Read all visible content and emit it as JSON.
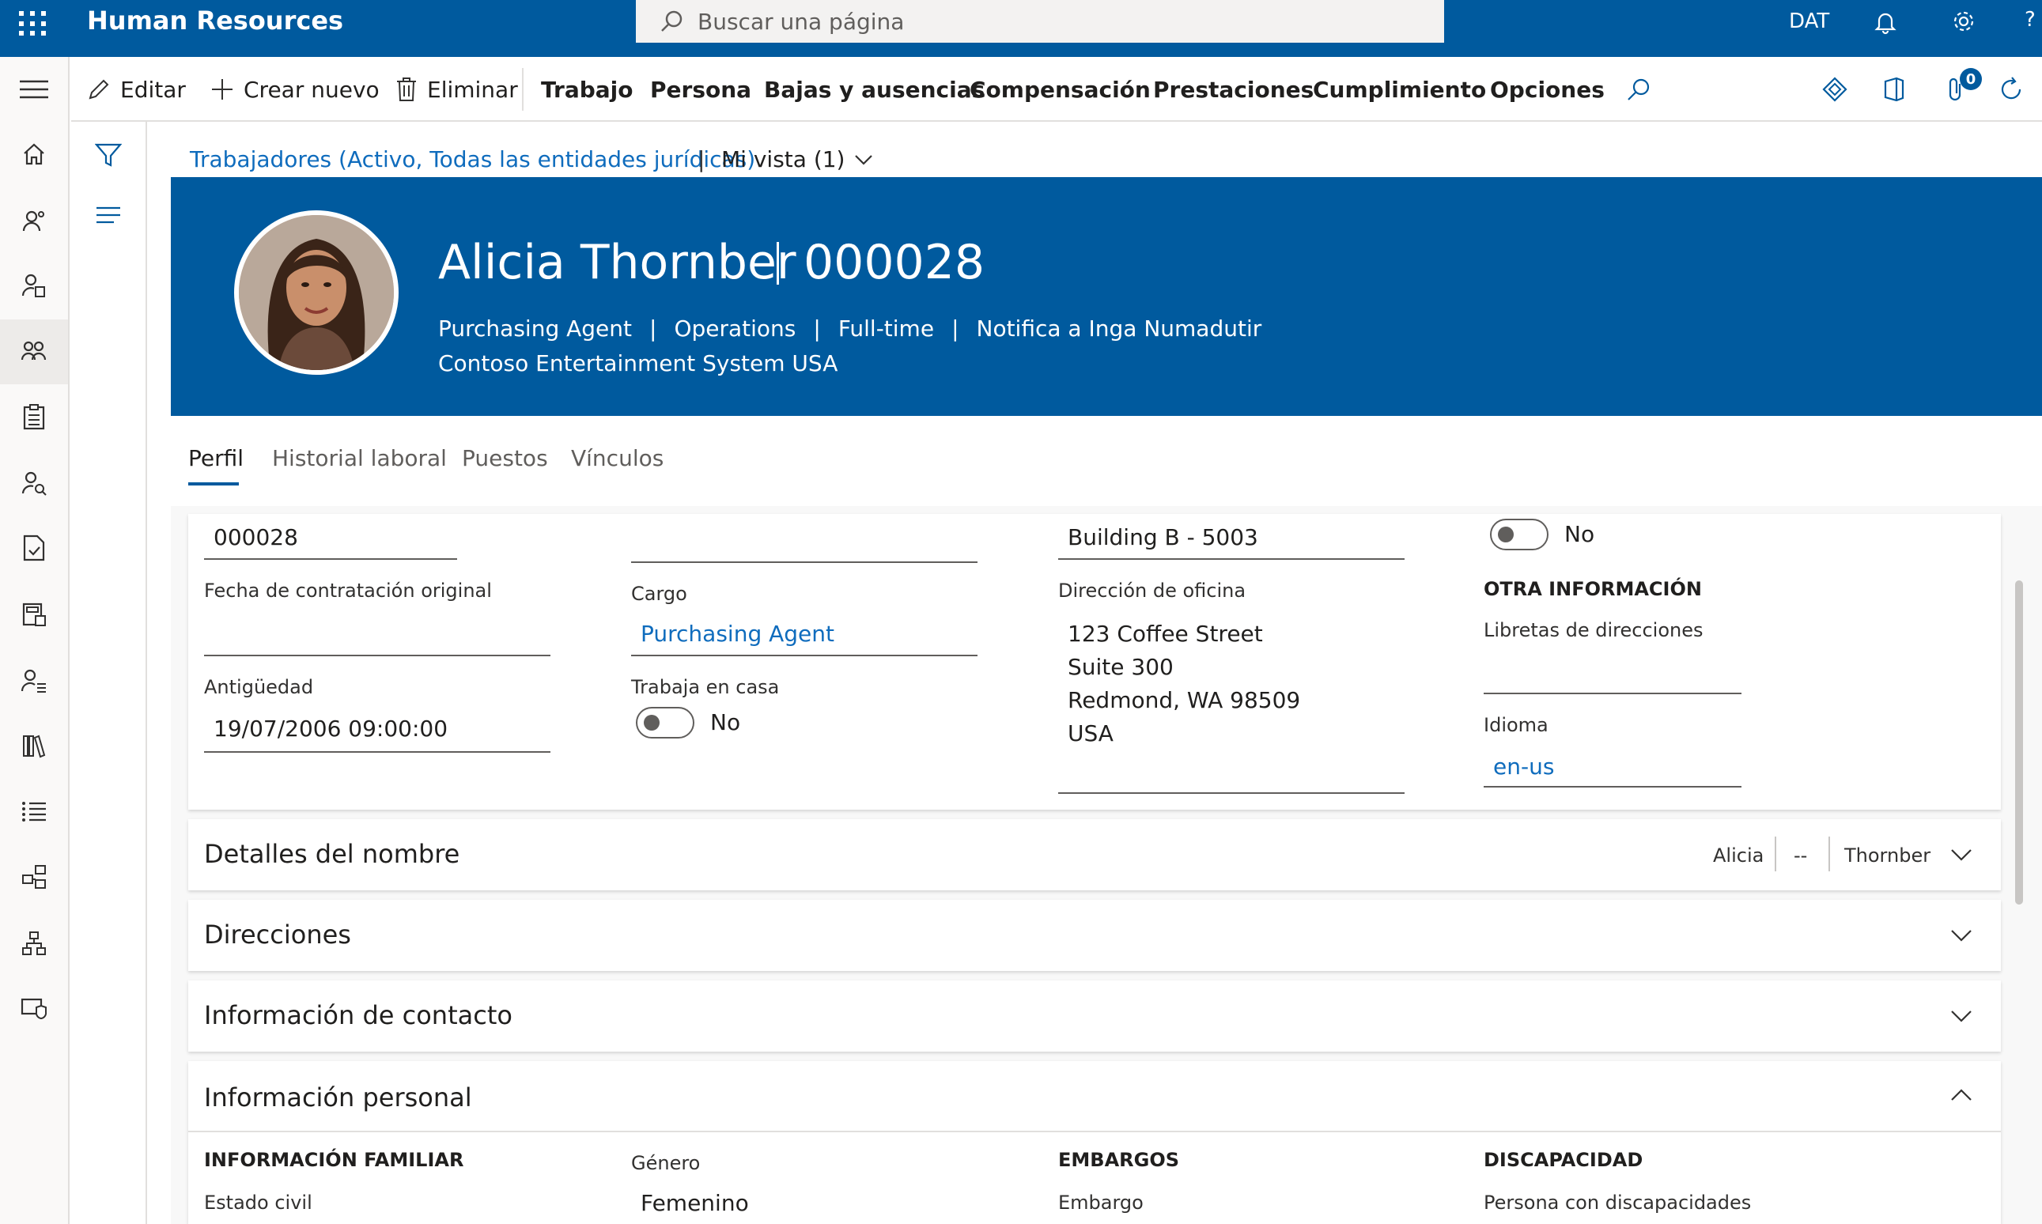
{
  "app": {
    "title": "Human Resources",
    "search_placeholder": "Buscar una página",
    "company": "DAT",
    "help": "?"
  },
  "commands": {
    "edit": "Editar",
    "new": "Crear nuevo",
    "delete": "Eliminar",
    "menus": [
      "Trabajo",
      "Persona",
      "Bajas y ausencias",
      "Compensación",
      "Prestaciones",
      "Cumplimiento",
      "Opciones"
    ],
    "attachments_count": "0"
  },
  "breadcrumb": {
    "list": "Trabajadores (Activo, Todas las entidades jurídicas)",
    "sep": "|",
    "view": "Mi vista (1)"
  },
  "header": {
    "name": "Alicia Thornber",
    "id": "000028",
    "title": "Purchasing Agent",
    "department": "Operations",
    "employment": "Full-time",
    "reports_to": "Notifica a Inga Numadutir",
    "company": "Contoso Entertainment System USA",
    "separator": "|"
  },
  "tabs": [
    "Perfil",
    "Historial laboral",
    "Puestos",
    "Vínculos"
  ],
  "profile": {
    "col1": {
      "personnel_number": "000028",
      "original_hire_label": "Fecha de contratación original",
      "original_hire_value": "",
      "seniority_label": "Antigüedad",
      "seniority_value": "19/07/2006 09:00:00"
    },
    "col2": {
      "top_value": "",
      "title_label": "Cargo",
      "title_value": "Purchasing Agent",
      "wfh_label": "Trabaja en casa",
      "wfh_value": "No"
    },
    "col3": {
      "office_value": "Building B - 5003",
      "office_address_label": "Dirección de oficina",
      "address_lines": [
        "123 Coffee Street",
        "Suite 300",
        "Redmond, WA 98509",
        "USA"
      ]
    },
    "col4": {
      "toggle_value": "No",
      "other_info_header": "OTRA INFORMACIÓN",
      "address_books_label": "Libretas de direcciones",
      "address_books_value": "",
      "language_label": "Idioma",
      "language_value": "en-us"
    }
  },
  "fasttabs": {
    "name_details": {
      "title": "Detalles del nombre",
      "first": "Alicia",
      "middle": "--",
      "last": "Thornber"
    },
    "addresses": {
      "title": "Direcciones"
    },
    "contact": {
      "title": "Información de contacto"
    },
    "personal": {
      "title": "Información personal",
      "family_header": "INFORMACIÓN FAMILIAR",
      "marital_label": "Estado civil",
      "gender_label": "Género",
      "gender_value": "Femenino",
      "garnish_header": "EMBARGOS",
      "garnish_label": "Embargo",
      "disability_header": "DISCAPACIDAD",
      "disability_label": "Persona con discapacidades"
    }
  },
  "colors": {
    "brand": "#005a9e",
    "link": "#0f6cbd"
  }
}
